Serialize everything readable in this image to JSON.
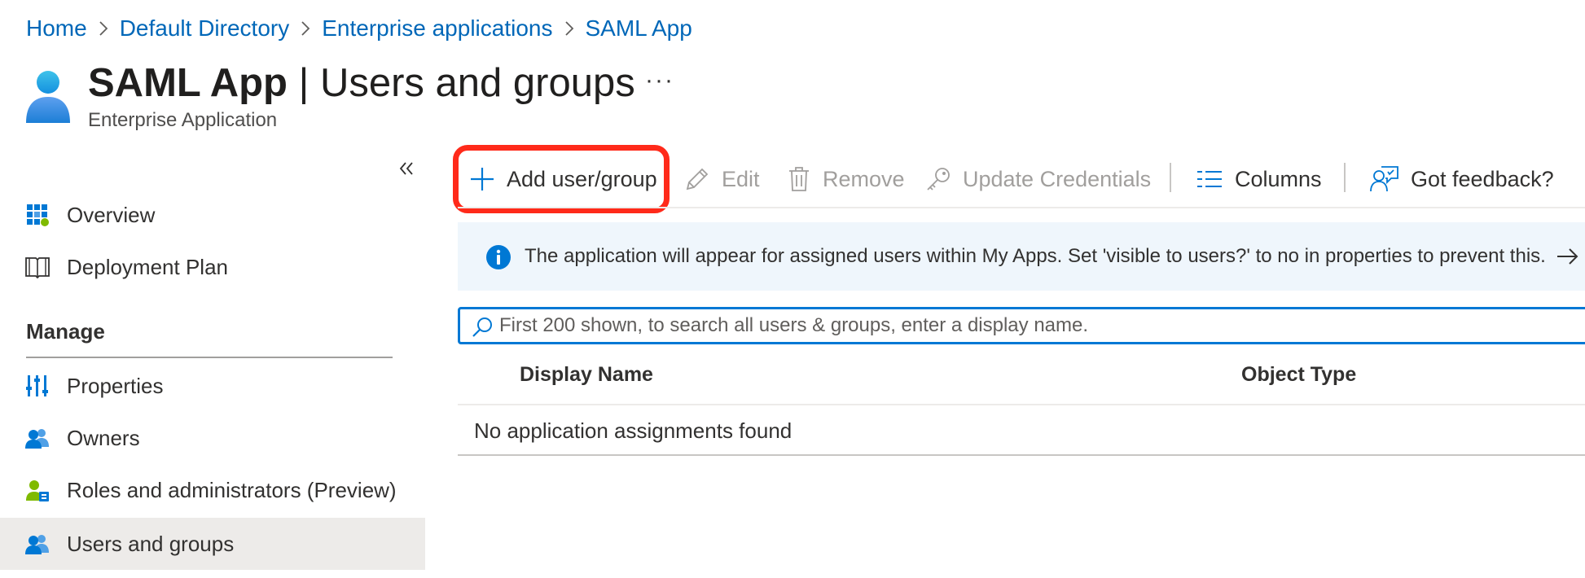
{
  "breadcrumb": [
    {
      "label": "Home"
    },
    {
      "label": "Default Directory"
    },
    {
      "label": "Enterprise applications"
    },
    {
      "label": "SAML App"
    }
  ],
  "header": {
    "app_name": "SAML App",
    "title_sep": " | ",
    "page_name": "Users and groups",
    "subtitle": "Enterprise Application",
    "more_label": "···"
  },
  "sidebar": {
    "collapse_icon": "double-chevron-left-icon",
    "items_top": [
      {
        "label": "Overview",
        "icon": "grid-icon"
      },
      {
        "label": "Deployment Plan",
        "icon": "book-icon"
      }
    ],
    "section_heading": "Manage",
    "items_manage": [
      {
        "label": "Properties",
        "icon": "properties-icon"
      },
      {
        "label": "Owners",
        "icon": "users-icon"
      },
      {
        "label": "Roles and administrators (Preview)",
        "icon": "role-user-icon"
      },
      {
        "label": "Users and groups",
        "icon": "users-icon",
        "active": true
      }
    ]
  },
  "toolbar": {
    "add_label": "Add user/group",
    "edit_label": "Edit",
    "remove_label": "Remove",
    "update_credentials_label": "Update Credentials",
    "columns_label": "Columns",
    "feedback_label": "Got feedback?"
  },
  "info_banner": {
    "text": "The application will appear for assigned users within My Apps. Set 'visible to users?' to no in properties to prevent this."
  },
  "search": {
    "placeholder": "First 200 shown, to search all users & groups, enter a display name.",
    "value": ""
  },
  "table": {
    "columns": [
      "Display Name",
      "Object Type"
    ],
    "empty_message": "No application assignments found"
  },
  "colors": {
    "link": "#0067b8",
    "accent": "#0078d4",
    "highlight": "#ff2a1a",
    "banner_bg": "#eff6fc",
    "active_nav_bg": "#edebe9"
  }
}
